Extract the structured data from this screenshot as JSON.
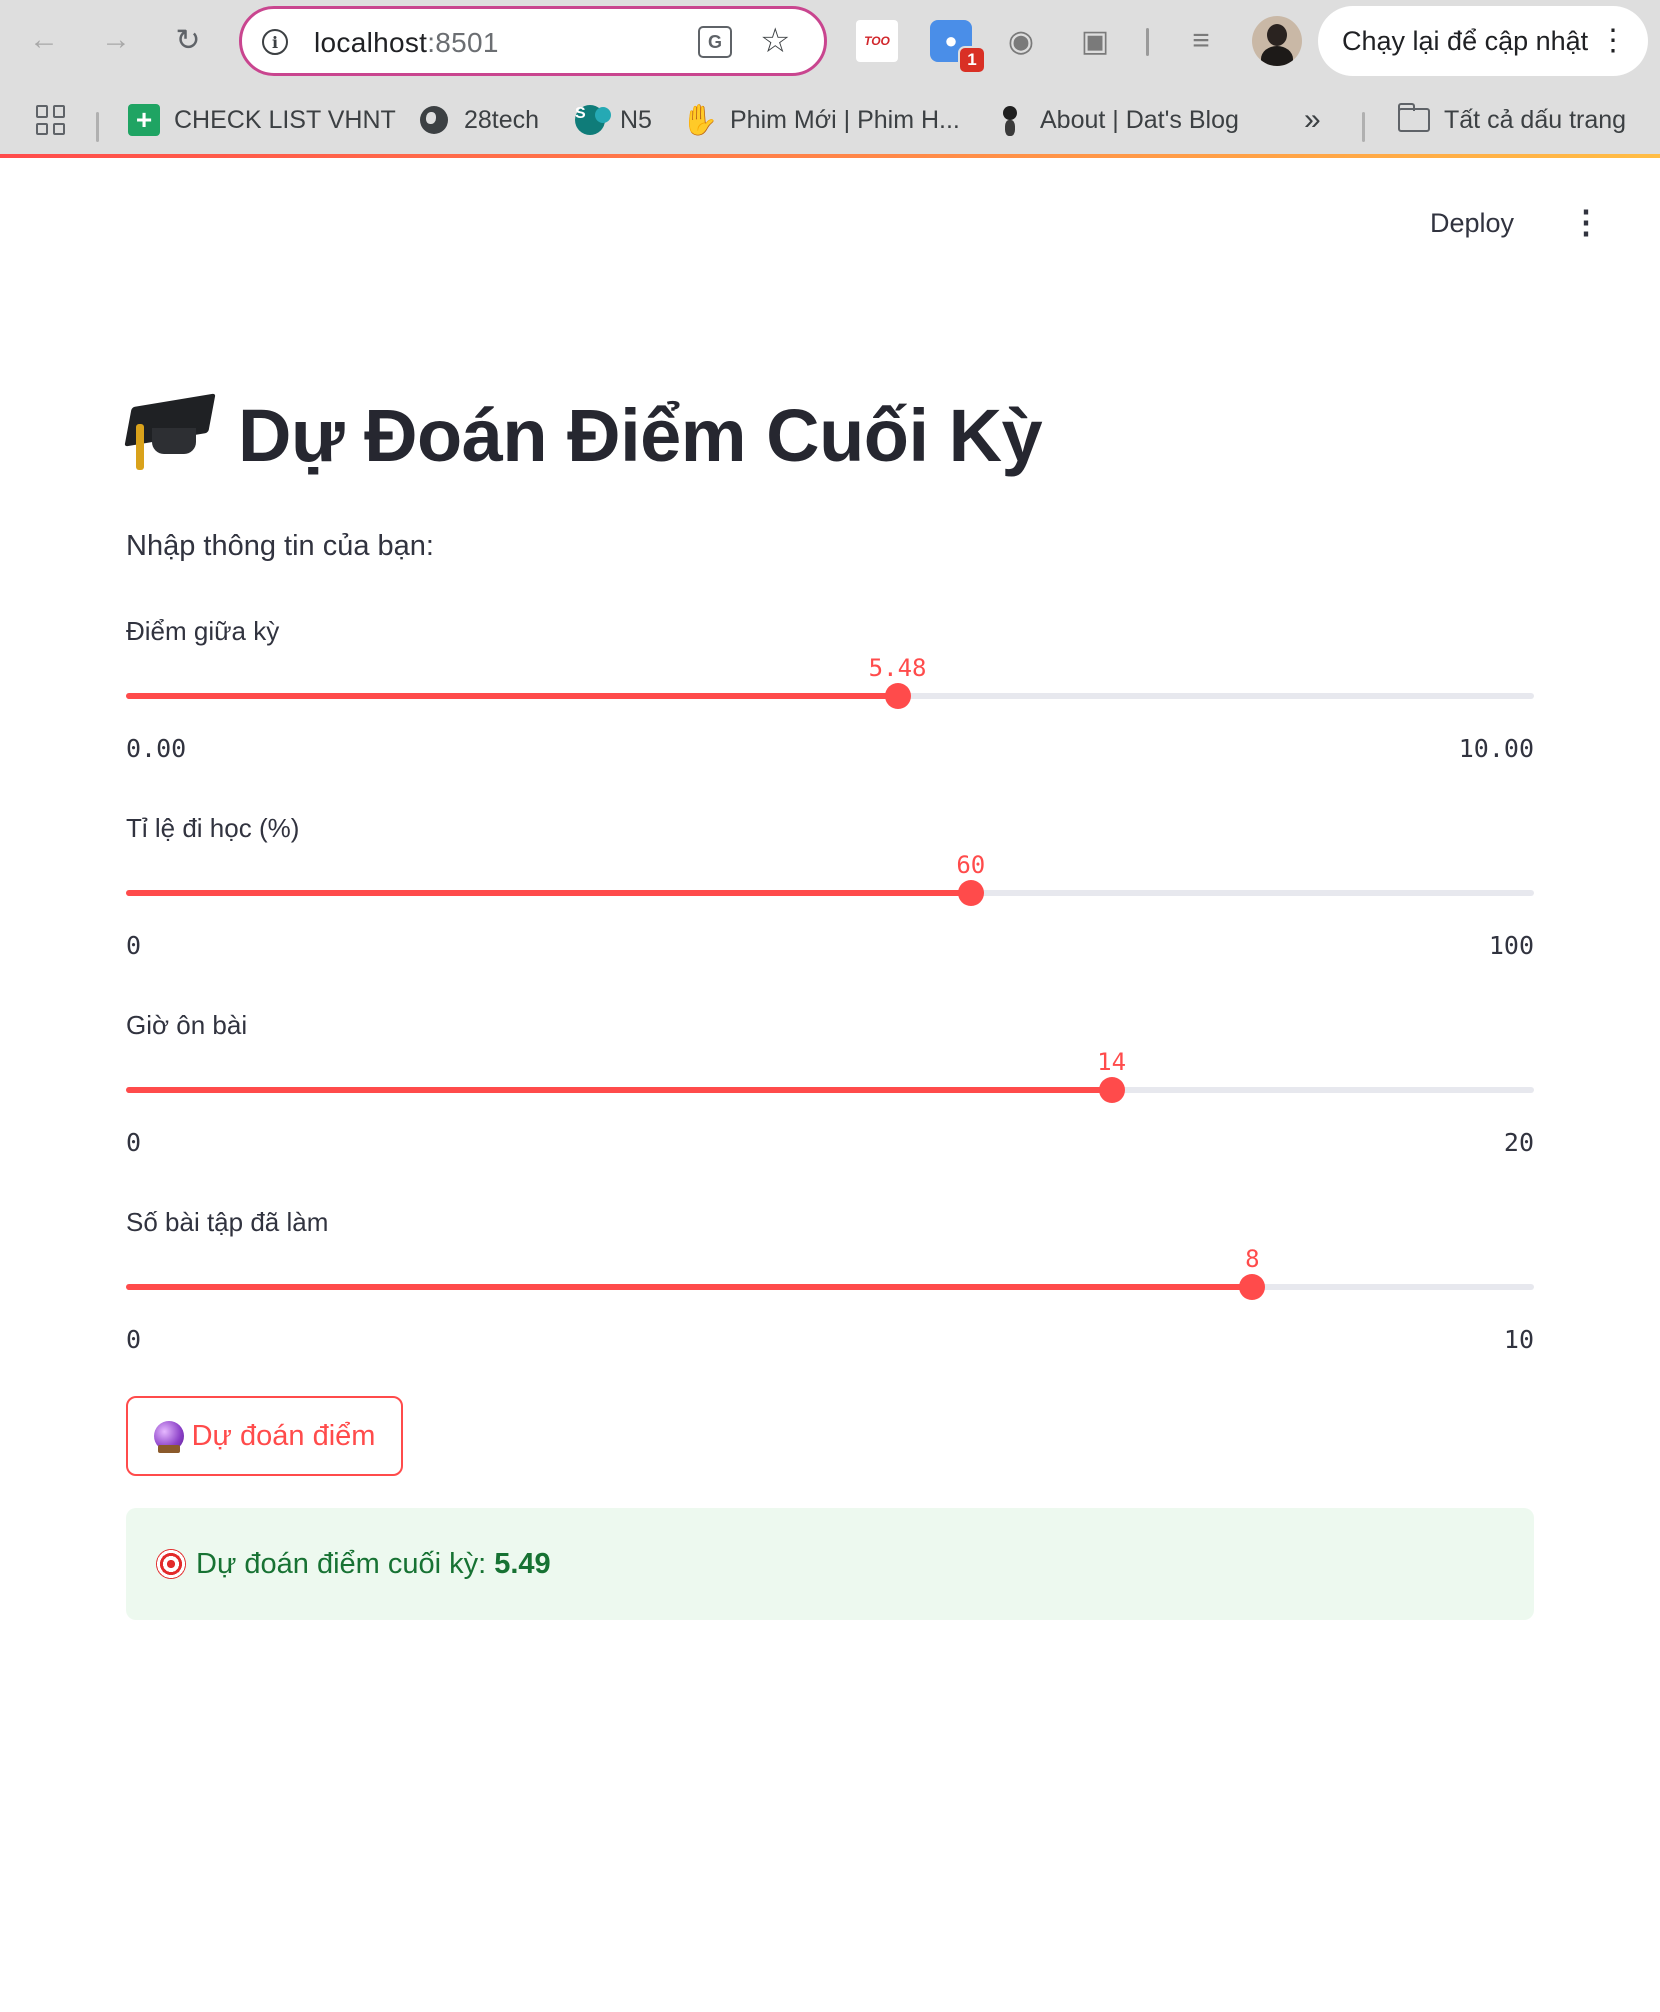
{
  "browser": {
    "url_host": "localhost",
    "url_port": ":8501",
    "translate_glyph": "G",
    "ext_red_text": "TOO",
    "ext_badge": "1",
    "relaunch_label": "Chạy lại để cập nhật",
    "bookmarks": [
      {
        "label": "CHECK LIST VHNT",
        "icon": "sheets-icon"
      },
      {
        "label": "28tech",
        "icon": "globe-icon"
      },
      {
        "label": "N5",
        "icon": "sharepoint-icon"
      },
      {
        "label": "Phim Mới | Phim H...",
        "icon": "rock-hand-icon"
      },
      {
        "label": "About | Dat's Blog",
        "icon": "ant-icon"
      }
    ],
    "bookmarks_overflow": "»",
    "all_bookmarks_label": "Tất cả dấu trang"
  },
  "app": {
    "deploy_label": "Deploy",
    "title": "Dự Đoán Điểm Cuối Kỳ",
    "subtitle": "Nhập thông tin của bạn:",
    "sliders": [
      {
        "label": "Điểm giữa kỳ",
        "value": 5.48,
        "value_text": "5.48",
        "min": 0,
        "max": 10,
        "min_text": "0.00",
        "max_text": "10.00"
      },
      {
        "label": "Tỉ lệ đi học (%)",
        "value": 60,
        "value_text": "60",
        "min": 0,
        "max": 100,
        "min_text": "0",
        "max_text": "100"
      },
      {
        "label": "Giờ ôn bài",
        "value": 14,
        "value_text": "14",
        "min": 0,
        "max": 20,
        "min_text": "0",
        "max_text": "20"
      },
      {
        "label": "Số bài tập đã làm",
        "value": 8,
        "value_text": "8",
        "min": 0,
        "max": 10,
        "min_text": "0",
        "max_text": "10"
      }
    ],
    "predict_button": "Dự đoán điểm",
    "result_label": "Dự đoán điểm cuối kỳ:",
    "result_value": "5.49",
    "colors": {
      "accent": "#ff4b4b",
      "success_bg": "#edf9ef",
      "success_text": "#177233"
    }
  }
}
